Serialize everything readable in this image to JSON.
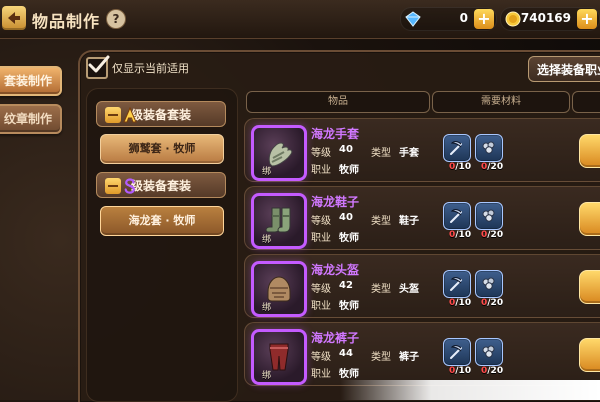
{
  "header": {
    "title": "物品制作",
    "help_symbol": "?",
    "diamonds": "0",
    "coins": "740169",
    "plus_symbol": "+"
  },
  "sidebar": {
    "tabs": [
      {
        "label": "套装制作",
        "active": true
      },
      {
        "label": "纹章制作",
        "active": false
      }
    ]
  },
  "filters": {
    "only_current_label": "仅显示当前适用",
    "select_button": "选择装备职业"
  },
  "categories": {
    "groups": [
      {
        "label": "级装备套装",
        "rank": "A",
        "expanded": true,
        "items": [
          {
            "label": "狮鹫套 · 牧师",
            "selected": false
          }
        ]
      },
      {
        "label": "级装备套装",
        "rank": "S",
        "expanded": true,
        "items": [
          {
            "label": "海龙套 · 牧师",
            "selected": true
          }
        ]
      }
    ]
  },
  "table": {
    "headers": [
      "物品",
      "需要材料",
      ""
    ],
    "rows": [
      {
        "name": "海龙手套",
        "bind": "绑",
        "level_label": "等级",
        "level": "40",
        "job_label": "职业",
        "job": "牧师",
        "type_label": "类型",
        "type": "手套",
        "mat1_need": "/10",
        "mat2_need": "/20"
      },
      {
        "name": "海龙鞋子",
        "bind": "绑",
        "level_label": "等级",
        "level": "40",
        "job_label": "职业",
        "job": "牧师",
        "type_label": "类型",
        "type": "鞋子",
        "mat1_need": "/10",
        "mat2_need": "/20"
      },
      {
        "name": "海龙头盔",
        "bind": "绑",
        "level_label": "等级",
        "level": "42",
        "job_label": "职业",
        "job": "牧师",
        "type_label": "类型",
        "type": "头盔",
        "mat1_need": "/10",
        "mat2_need": "/20"
      },
      {
        "name": "海龙裤子",
        "bind": "绑",
        "level_label": "等级",
        "level": "44",
        "job_label": "职业",
        "job": "牧师",
        "type_label": "类型",
        "type": "裤子",
        "mat1_need": "/10",
        "mat2_need": "/20"
      }
    ],
    "mat1_have": "0",
    "mat2_have": "0"
  },
  "colors": {
    "accent_gold": "#ffd86a",
    "epic_purple": "#c45bff",
    "panel_brown": "#2b1f17",
    "blue_material": "#3f5f8d"
  },
  "icons": {
    "back": "back-arrow-icon",
    "help": "help-icon",
    "diamond": "diamond-icon",
    "coin": "coin-icon",
    "check": "check-icon",
    "rank_a": "rank-a-icon",
    "rank_s": "rank-s-icon",
    "material_scythe": "material-scythe-icon",
    "material_ore": "material-ore-icon"
  }
}
